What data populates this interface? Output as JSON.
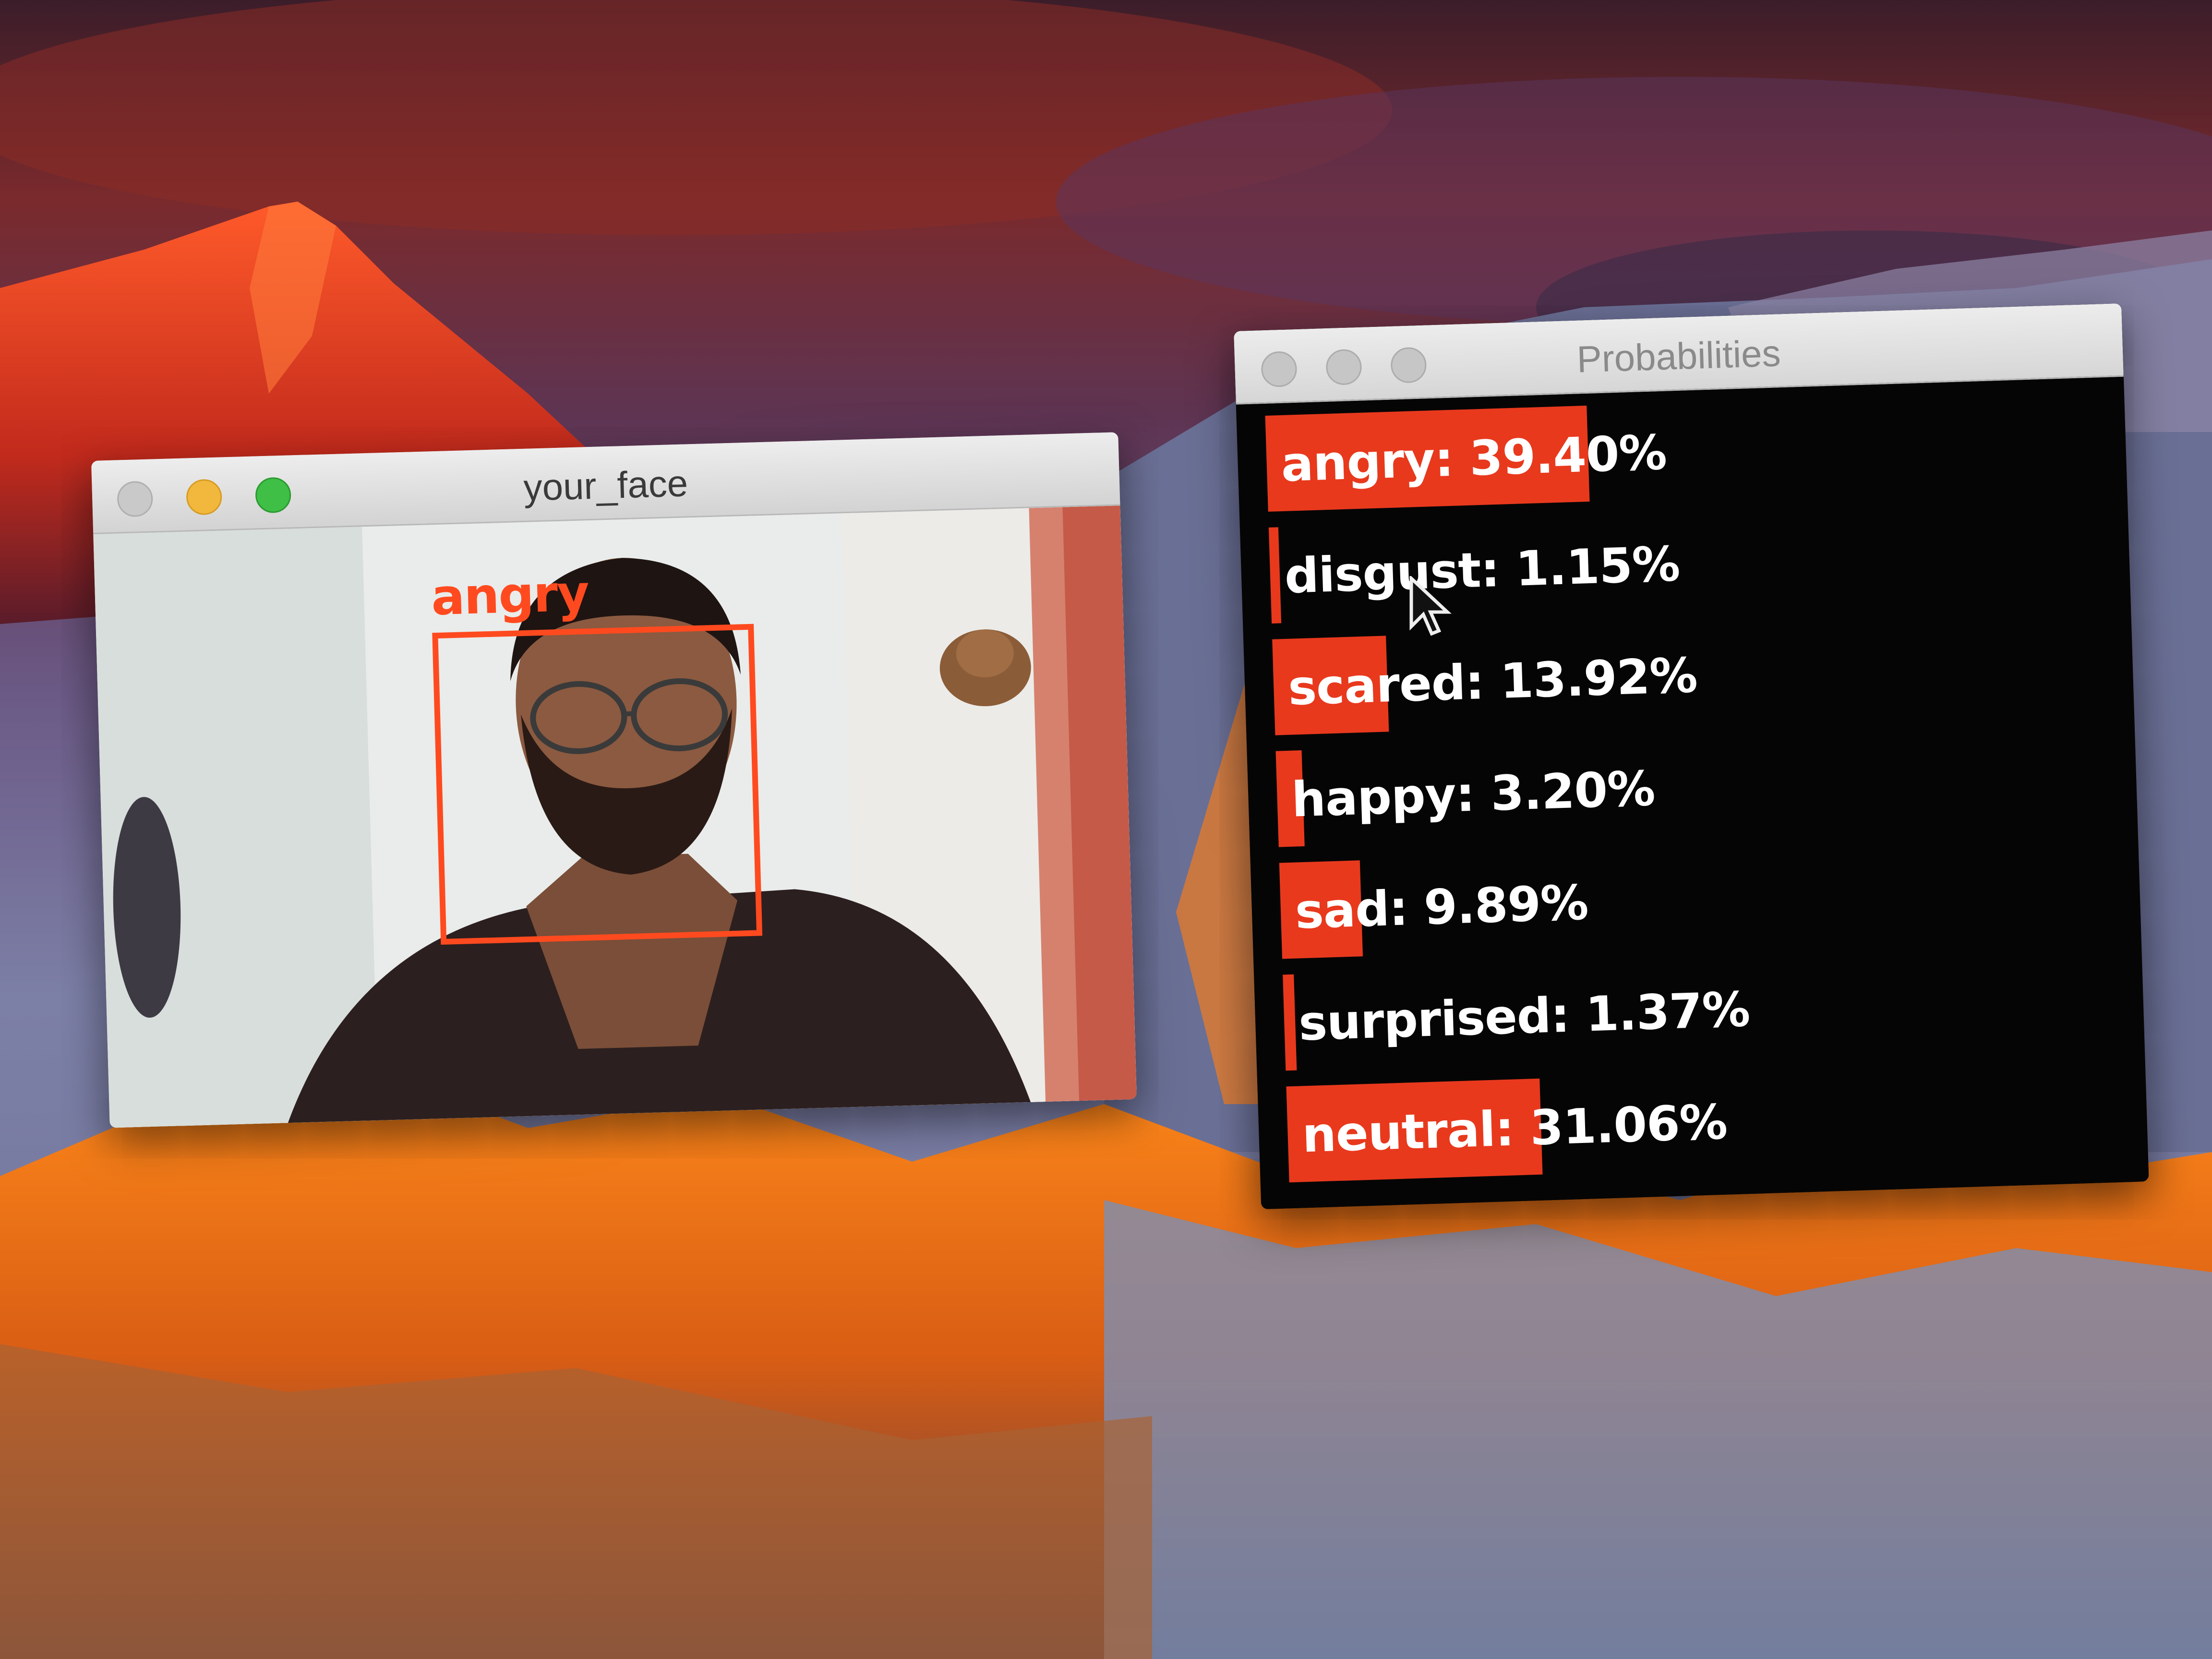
{
  "windows": {
    "face": {
      "title": "your_face",
      "detection_label": "angry"
    },
    "probabilities": {
      "title": "Probabilities",
      "max_width_units": 1700,
      "rows": [
        {
          "text": "angry: 39.40%",
          "fraction": 0.394
        },
        {
          "text": "disgust: 1.15%",
          "fraction": 0.0115
        },
        {
          "text": "scared: 13.92%",
          "fraction": 0.1392
        },
        {
          "text": "happy: 3.20%",
          "fraction": 0.032
        },
        {
          "text": "sad: 9.89%",
          "fraction": 0.0989
        },
        {
          "text": "surprised: 1.37%",
          "fraction": 0.0137
        },
        {
          "text": "neutral: 31.06%",
          "fraction": 0.3106
        }
      ],
      "bar_color": "#e8391d"
    }
  },
  "icons": [
    "close-icon",
    "minimize-icon",
    "maximize-icon",
    "mouse-pointer-icon"
  ],
  "colors": {
    "detection_box": "#ff4a1f",
    "bar": "#e8391d",
    "prob_background": "#060505"
  }
}
